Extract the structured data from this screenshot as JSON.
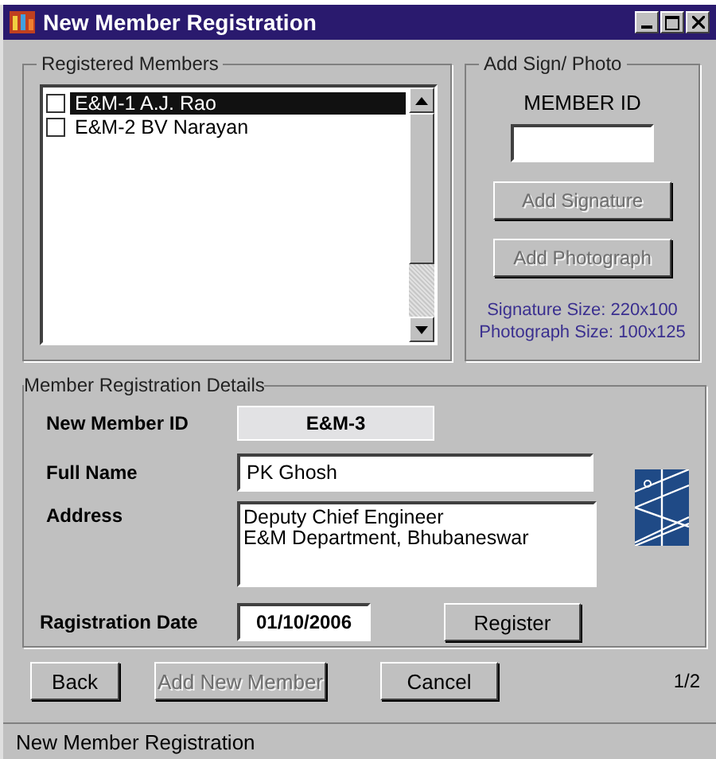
{
  "window": {
    "title": "New Member Registration"
  },
  "members_group": {
    "title": "Registered Members",
    "items": [
      {
        "label": "E&M-1  A.J. Rao",
        "checked": false,
        "selected": true
      },
      {
        "label": "E&M-2  BV Narayan",
        "checked": false,
        "selected": false
      }
    ]
  },
  "sign_group": {
    "title": "Add Sign/ Photo",
    "member_id_label": "MEMBER ID",
    "buttons": [
      {
        "label": "Add Signature",
        "disabled": true
      },
      {
        "label": "Add Photograph",
        "disabled": true
      }
    ],
    "notes": [
      "Signature Size: 220x100",
      "Photograph Size: 100x125"
    ]
  },
  "details": {
    "title": "Member Registration Details",
    "new_member_id_label": "New Member ID",
    "new_member_id": "E&M-3",
    "full_name_label": "Full Name",
    "full_name": "PK Ghosh",
    "address_label": "Address",
    "address_lines": [
      "Deputy Chief Engineer",
      "E&M Department, Bhubaneswar"
    ],
    "date_label": "Ragistration Date",
    "date": "01/10/2006",
    "register": "Register"
  },
  "buttons": [
    {
      "label": "Back",
      "disabled": false
    },
    {
      "label": "Add New Member",
      "disabled": true
    },
    {
      "label": "Cancel",
      "disabled": false
    }
  ],
  "page": "1/2",
  "status_bar": "New Member Registration"
}
